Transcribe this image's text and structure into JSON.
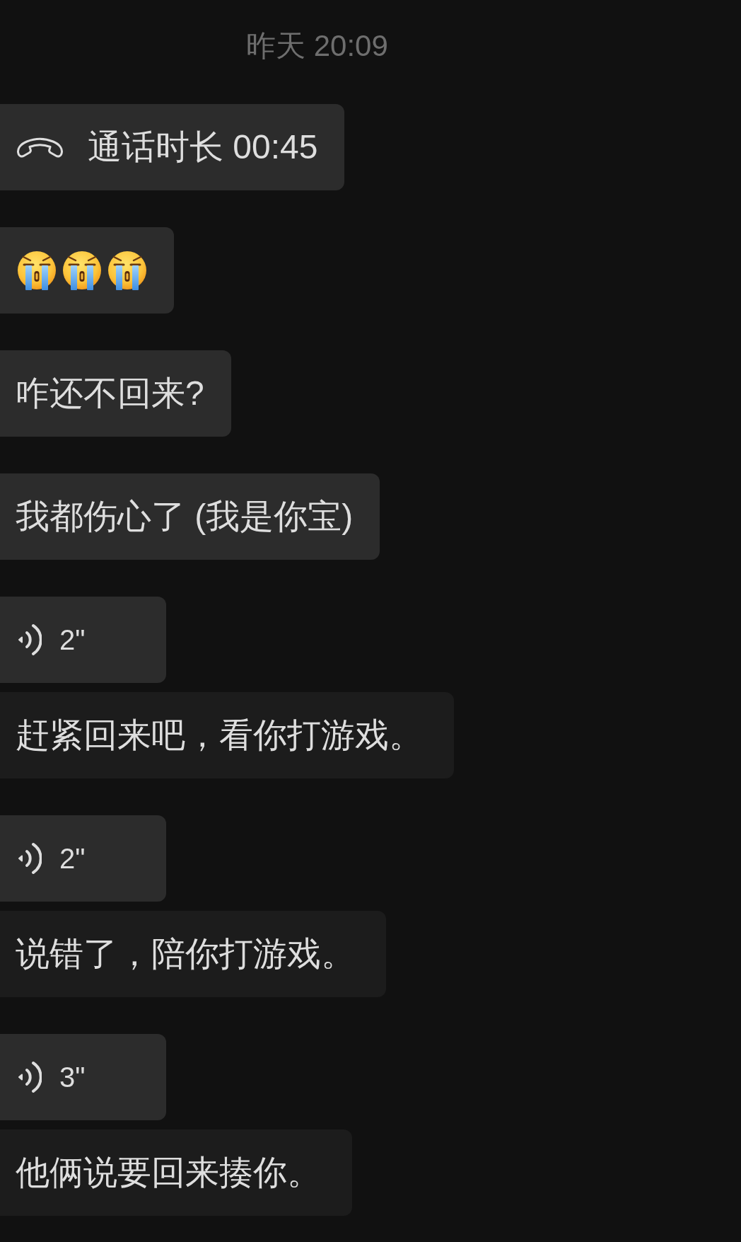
{
  "timestamp": "昨天 20:09",
  "messages": [
    {
      "kind": "call",
      "text": "通话时长 00:45"
    },
    {
      "kind": "emoji",
      "emojis": [
        {
          "kind": "loudly-crying"
        },
        {
          "kind": "loudly-crying"
        },
        {
          "kind": "loudly-crying"
        }
      ]
    },
    {
      "kind": "text",
      "text": "咋还不回来?"
    },
    {
      "kind": "text",
      "text": "我都伤心了 (我是你宝)"
    },
    {
      "kind": "voice",
      "duration": "2\"",
      "transcription": "赶紧回来吧，看你打游戏。"
    },
    {
      "kind": "voice",
      "duration": "2\"",
      "transcription": "说错了，陪你打游戏。"
    },
    {
      "kind": "voice",
      "duration": "3\"",
      "transcription": "他俩说要回来揍你。"
    }
  ]
}
